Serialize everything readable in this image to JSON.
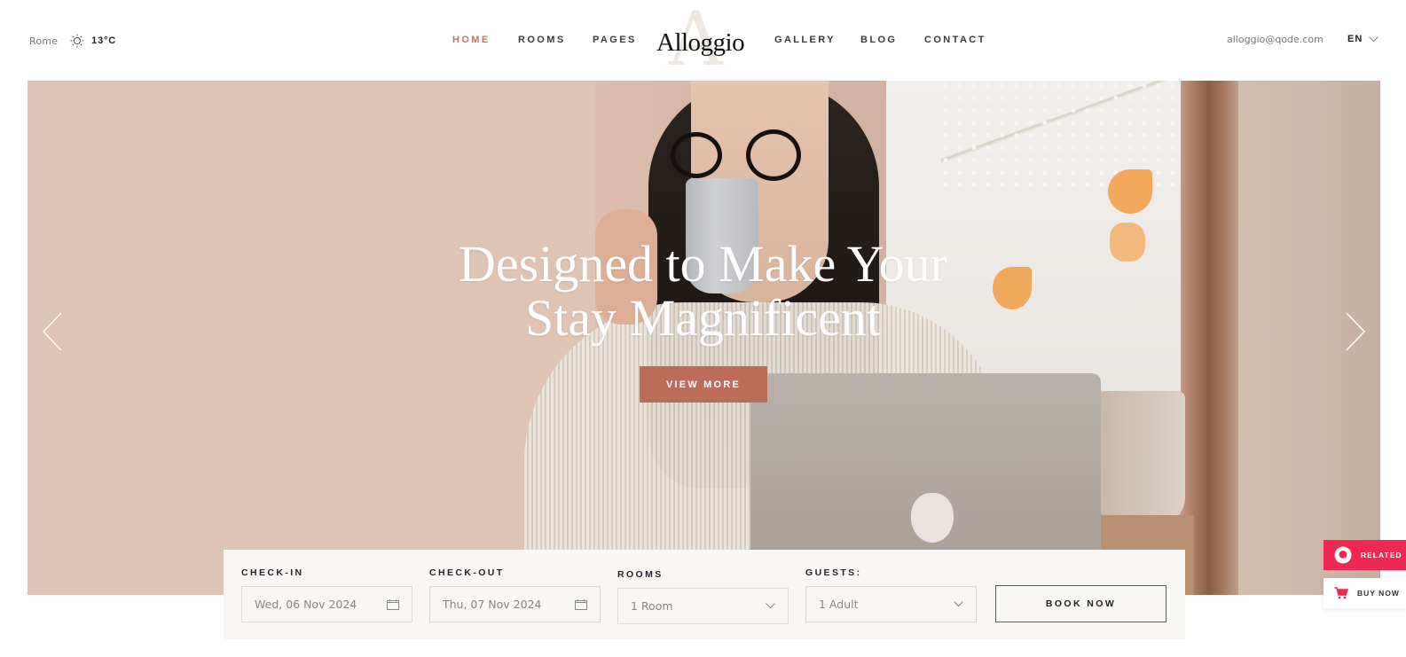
{
  "header": {
    "weather": {
      "city": "Rome",
      "icon": "sun-icon",
      "temperature": "13°C"
    },
    "nav_left": [
      {
        "label": "HOME",
        "active": true
      },
      {
        "label": "ROOMS",
        "active": false
      },
      {
        "label": "PAGES",
        "active": false
      }
    ],
    "logo": {
      "monogram": "A",
      "wordmark": "Alloggio"
    },
    "nav_right": [
      {
        "label": "GALLERY",
        "active": false
      },
      {
        "label": "BLOG",
        "active": false
      },
      {
        "label": "CONTACT",
        "active": false
      }
    ],
    "email": "alloggio@qode.com",
    "language": {
      "selected": "EN",
      "icon": "chevron-down-icon"
    }
  },
  "hero": {
    "title_line1": "Designed to Make Your",
    "title_line2": "Stay Magnificent",
    "cta_label": "VIEW MORE",
    "prev_icon": "chevron-left-icon",
    "next_icon": "chevron-right-icon"
  },
  "booking": {
    "check_in": {
      "label": "CHECK-IN",
      "value": "Wed, 06 Nov 2024",
      "icon": "calendar-icon"
    },
    "check_out": {
      "label": "CHECK-OUT",
      "value": "Thu, 07 Nov 2024",
      "icon": "calendar-icon"
    },
    "rooms": {
      "label": "ROOMS",
      "value": "1 Room",
      "icon": "chevron-down-icon"
    },
    "guests": {
      "label": "GUESTS:",
      "value": "1 Adult",
      "icon": "chevron-down-icon"
    },
    "submit_label": "BOOK NOW"
  },
  "widgets": {
    "related": {
      "label": "RELATED",
      "icon": "related-icon"
    },
    "buy_now": {
      "label": "BUY NOW",
      "icon": "cart-icon"
    }
  },
  "colors": {
    "accent": "#bd6c58",
    "nav_active": "#b97a6a",
    "related_bg": "#ee2852",
    "booking_bg": "#f9f7f3"
  }
}
